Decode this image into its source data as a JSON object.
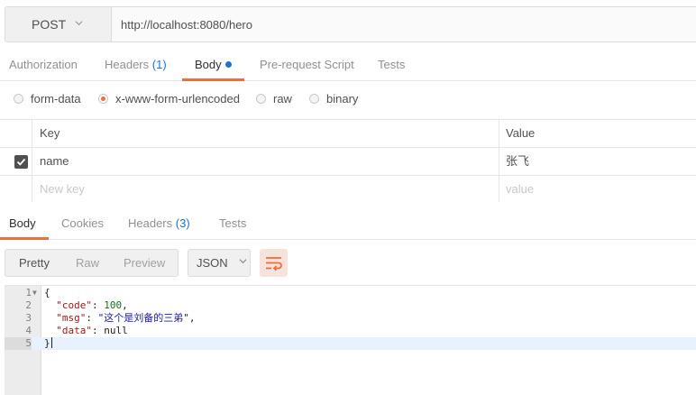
{
  "request": {
    "method": "POST",
    "url": "http://localhost:8080/hero"
  },
  "request_tabs": [
    {
      "label": "Authorization"
    },
    {
      "label": "Headers",
      "count": "(1)"
    },
    {
      "label": "Body"
    },
    {
      "label": "Pre-request Script"
    },
    {
      "label": "Tests"
    }
  ],
  "body_types": [
    {
      "label": "form-data",
      "selected": false
    },
    {
      "label": "x-www-form-urlencoded",
      "selected": true
    },
    {
      "label": "raw",
      "selected": false
    },
    {
      "label": "binary",
      "selected": false
    }
  ],
  "params_table": {
    "headers": {
      "key": "Key",
      "value": "Value"
    },
    "rows": [
      {
        "checked": true,
        "key": "name",
        "value": "张飞"
      }
    ],
    "placeholder": {
      "key": "New key",
      "value": "value"
    }
  },
  "response_tabs": [
    {
      "label": "Body"
    },
    {
      "label": "Cookies"
    },
    {
      "label": "Headers",
      "count": "(3)"
    },
    {
      "label": "Tests"
    }
  ],
  "view_modes": [
    "Pretty",
    "Raw",
    "Preview"
  ],
  "format": "JSON",
  "code_lines": [
    {
      "n": "1",
      "text": "{"
    },
    {
      "n": "2",
      "key": "\"code\"",
      "sep": ": ",
      "val": "100",
      "tail": ","
    },
    {
      "n": "3",
      "key": "\"msg\"",
      "sep": ": ",
      "val": "\"这个是刘备的三弟\"",
      "tail": ","
    },
    {
      "n": "4",
      "key": "\"data\"",
      "sep": ": ",
      "val": "null",
      "tail": ""
    },
    {
      "n": "5",
      "text": "}"
    }
  ],
  "colors": {
    "accent": "#f26b3a",
    "link_blue": "#1c73c9",
    "highlight_line": "#e8f2fe"
  },
  "icons": {
    "method_dropdown": "chevron-down-icon",
    "checkbox": "check-icon",
    "format_dropdown": "chevron-down-icon",
    "wrap": "wrap-lines-icon"
  }
}
